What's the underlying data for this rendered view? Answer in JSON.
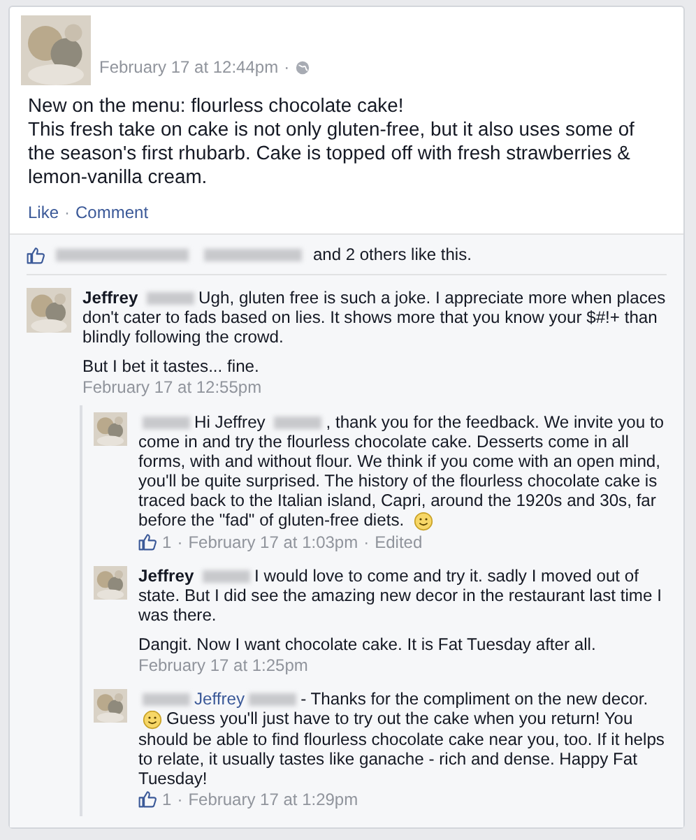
{
  "post": {
    "time": "February 17 at 12:44pm",
    "separator": "·",
    "paragraphs": [
      "New on the menu: flourless chocolate cake!",
      "This fresh take on cake is not only gluten-free, but it also uses some of the season's first rhubarb. Cake is topped off with fresh strawberries & lemon-vanilla cream."
    ],
    "actions": [
      "Like",
      "Comment"
    ]
  },
  "likes": {
    "text": "and 2 others like this."
  },
  "comments": [
    {
      "reply": false,
      "paragraphs": [
        [
          {
            "kind": "name",
            "text": "Jeffrey"
          },
          {
            "kind": "redacted"
          },
          {
            "kind": "text",
            "text": "Ugh, gluten free is such a joke. I appreciate more when places don't cater to fads based on lies. It shows more that you know your $#!+ than blindly following the crowd."
          }
        ],
        [
          {
            "kind": "text",
            "text": "But I bet it tastes... fine."
          }
        ]
      ],
      "time": "February 17 at 12:55pm"
    },
    {
      "reply": true,
      "paragraphs": [
        [
          {
            "kind": "redacted"
          },
          {
            "kind": "text",
            "text": "Hi Jeffrey"
          },
          {
            "kind": "redacted"
          },
          {
            "kind": "text",
            "text": ", thank you for the feedback. We invite you to come in and try the flourless chocolate cake. Desserts come in all forms, with and without flour. We think if you come with an open mind, you'll be quite surprised. The history of the flourless chocolate cake is traced back to the Italian island, Capri, around the 1920s and 30s, far before the \"fad\" of gluten-free diets."
          },
          {
            "kind": "smiley"
          }
        ]
      ],
      "likes": "1",
      "time": "February 17 at 1:03pm",
      "edited": "Edited"
    },
    {
      "reply": true,
      "paragraphs": [
        [
          {
            "kind": "name",
            "text": "Jeffrey"
          },
          {
            "kind": "redacted"
          },
          {
            "kind": "text",
            "text": "I would love to come and try it. sadly I moved out of state. But I did see the amazing new decor in the restaurant last time I was there."
          }
        ],
        [
          {
            "kind": "text",
            "text": "Dangit. Now I want chocolate cake. It is Fat Tuesday after all."
          }
        ]
      ],
      "time": "February 17 at 1:25pm"
    },
    {
      "reply": true,
      "paragraphs": [
        [
          {
            "kind": "redacted"
          },
          {
            "kind": "link",
            "text": "Jeffrey"
          },
          {
            "kind": "redacted"
          },
          {
            "kind": "text",
            "text": "- Thanks for the compliment on the new decor."
          },
          {
            "kind": "smiley"
          },
          {
            "kind": "text",
            "text": "Guess you'll just have to try out the cake when you return! You should be able to find flourless chocolate cake near you, too. If it helps to relate, it usually tastes like ganache - rich and dense. Happy Fat Tuesday!"
          }
        ]
      ],
      "likes": "1",
      "time": "February 17 at 1:29pm"
    }
  ]
}
